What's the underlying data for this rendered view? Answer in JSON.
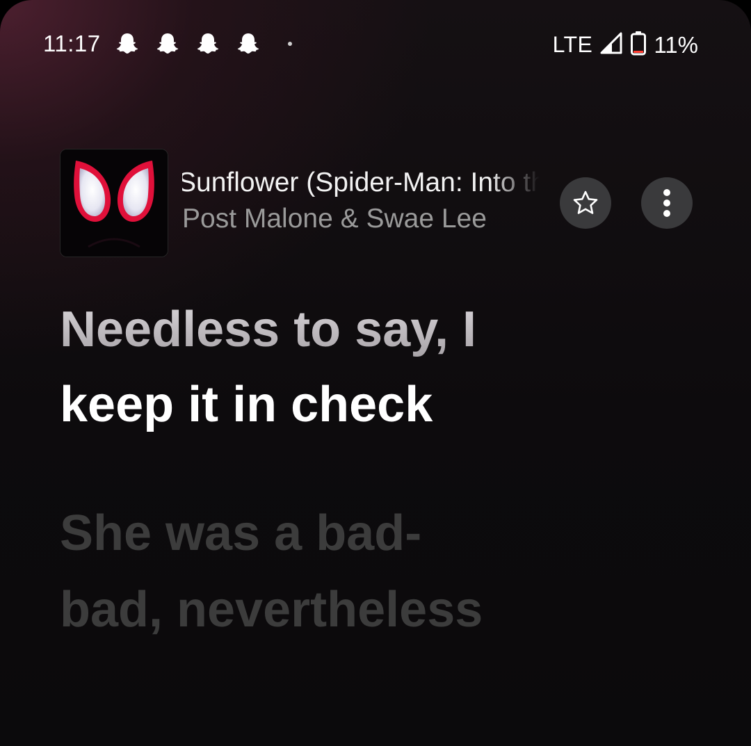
{
  "status_bar": {
    "time": "11:17",
    "notification_icons": [
      "snapchat-ghost-icon",
      "snapchat-ghost-icon",
      "snapchat-ghost-icon",
      "snapchat-ghost-icon"
    ],
    "network_type": "LTE",
    "signal_icon": "cellular-signal-icon",
    "battery_icon": "battery-low-icon",
    "battery_percent": "11%"
  },
  "now_playing": {
    "album_art": "spider-man-eyes-album-art",
    "title": "Sunflower (Spider-Man: Into the Spider-Verse)",
    "artist": "Post Malone & Swae Lee",
    "favorite_icon": "star-outline-icon",
    "more_icon": "more-vertical-icon"
  },
  "lyrics": {
    "current_line_sung": "Needless to say, I",
    "current_line_active": "keep it in check",
    "next_line": "She was a bad-bad, nevertheless"
  },
  "colors": {
    "background": "#0d0b0d",
    "background_glow": "#562234",
    "button_background": "#3a3a3c",
    "artist_text": "#9a9a9a",
    "upcoming_lyric": "#3c3c3c",
    "album_eye_red": "#e0103a"
  }
}
